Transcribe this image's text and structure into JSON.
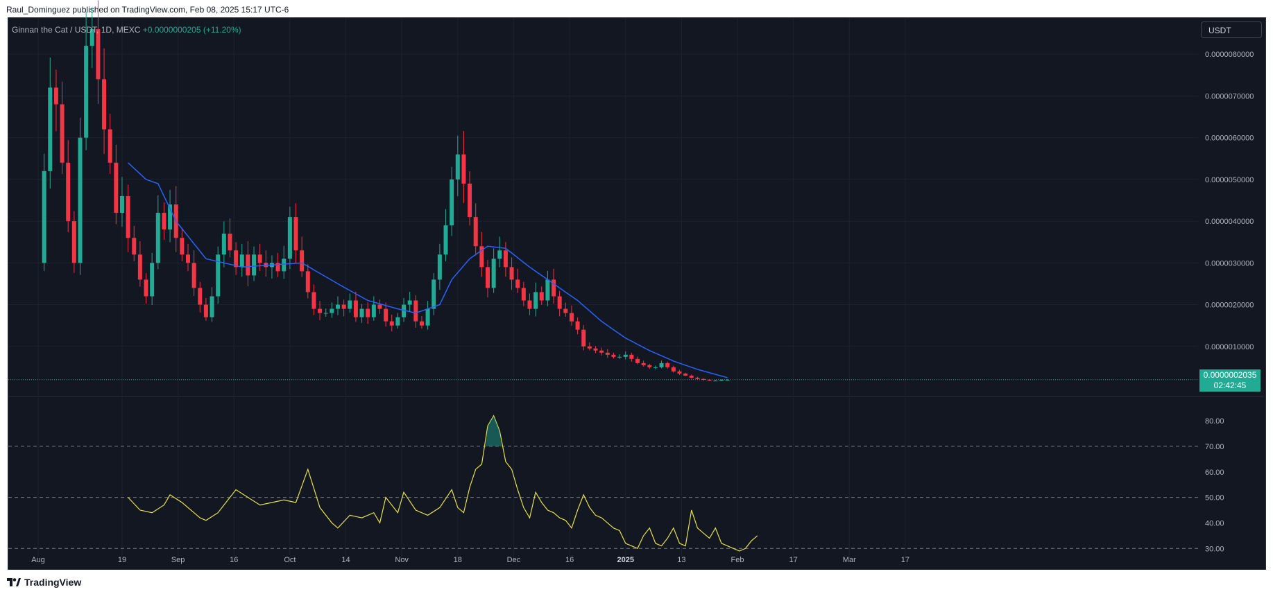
{
  "header": {
    "publisher_line": "Raul_Dominguez published on TradingView.com, Feb 08, 2025 15:17 UTC-6"
  },
  "footer": {
    "brand": "TradingView"
  },
  "legend": {
    "symbol": "Ginnan the Cat / USDT, 1D, MEXC",
    "change": "+0.0000000205 (+11.20%)"
  },
  "currency_button": "USDT",
  "last_price": {
    "value": "0.0000002035",
    "countdown": "02:42:45"
  },
  "colors": {
    "background": "#131722",
    "up": "#22ab94",
    "down": "#f23645",
    "ma": "#2962ff",
    "rsi": "#e6e24a",
    "grid": "#1e222d",
    "text": "#b2b5be"
  },
  "chart_data": [
    {
      "type": "candlestick",
      "title": "Ginnan the Cat / USDT, 1D, MEXC",
      "x_tick_labels": [
        "Aug",
        "19",
        "Sep",
        "16",
        "Oct",
        "14",
        "Nov",
        "18",
        "Dec",
        "16",
        "2025",
        "13",
        "Feb",
        "17",
        "Mar",
        "17"
      ],
      "y_tick_labels": [
        "0.0000080000",
        "0.0000070000",
        "0.0000060000",
        "0.0000050000",
        "0.0000040000",
        "0.0000030000",
        "0.0000020000",
        "0.0000010000"
      ],
      "ylim": [
        0,
        8.8e-06
      ],
      "last_price": 2.035e-07,
      "series": [
        {
          "name": "price",
          "kind": "ohlc",
          "anchors": [
            [
              0,
              3.0
            ],
            [
              1,
              5.2
            ],
            [
              2,
              7.2
            ],
            [
              3,
              6.8
            ],
            [
              4,
              5.4
            ],
            [
              5,
              4.0
            ],
            [
              6,
              3.0
            ],
            [
              7,
              6.0
            ],
            [
              8,
              8.2
            ],
            [
              9,
              8.6
            ],
            [
              10,
              7.4
            ],
            [
              11,
              6.2
            ],
            [
              12,
              5.4
            ],
            [
              13,
              4.2
            ],
            [
              14,
              4.6
            ],
            [
              15,
              3.6
            ],
            [
              16,
              3.2
            ],
            [
              17,
              2.6
            ],
            [
              18,
              2.2
            ],
            [
              19,
              3.0
            ],
            [
              20,
              4.2
            ],
            [
              21,
              3.8
            ],
            [
              22,
              4.4
            ],
            [
              23,
              3.6
            ],
            [
              24,
              3.2
            ],
            [
              25,
              3.0
            ],
            [
              26,
              2.4
            ],
            [
              27,
              2.0
            ],
            [
              28,
              1.7
            ],
            [
              29,
              2.2
            ],
            [
              30,
              3.2
            ],
            [
              31,
              3.7
            ],
            [
              32,
              3.3
            ],
            [
              33,
              2.9
            ],
            [
              34,
              3.2
            ],
            [
              35,
              2.7
            ],
            [
              36,
              3.2
            ],
            [
              37,
              3.0
            ],
            [
              38,
              2.9
            ],
            [
              39,
              3.0
            ],
            [
              40,
              2.8
            ],
            [
              41,
              3.1
            ],
            [
              42,
              4.1
            ],
            [
              43,
              3.3
            ],
            [
              44,
              2.8
            ],
            [
              45,
              2.3
            ],
            [
              46,
              1.9
            ],
            [
              47,
              1.8
            ],
            [
              48,
              1.8
            ],
            [
              49,
              1.9
            ],
            [
              50,
              2.0
            ],
            [
              51,
              1.9
            ],
            [
              52,
              2.1
            ],
            [
              53,
              1.7
            ],
            [
              54,
              1.9
            ],
            [
              55,
              1.7
            ],
            [
              56,
              2.0
            ],
            [
              57,
              1.9
            ],
            [
              58,
              1.6
            ],
            [
              59,
              1.5
            ],
            [
              60,
              1.7
            ],
            [
              61,
              2.0
            ],
            [
              62,
              2.1
            ],
            [
              63,
              1.6
            ],
            [
              64,
              1.5
            ],
            [
              65,
              1.9
            ],
            [
              66,
              2.6
            ],
            [
              67,
              3.2
            ],
            [
              68,
              3.9
            ],
            [
              69,
              5.0
            ],
            [
              70,
              5.6
            ],
            [
              71,
              4.9
            ],
            [
              72,
              4.1
            ],
            [
              73,
              3.4
            ],
            [
              74,
              2.9
            ],
            [
              75,
              2.4
            ],
            [
              76,
              3.1
            ],
            [
              77,
              3.3
            ],
            [
              78,
              2.9
            ],
            [
              79,
              2.6
            ],
            [
              80,
              2.4
            ],
            [
              81,
              2.1
            ],
            [
              82,
              1.9
            ],
            [
              83,
              2.3
            ],
            [
              84,
              2.1
            ],
            [
              85,
              2.6
            ],
            [
              86,
              2.2
            ],
            [
              87,
              1.9
            ],
            [
              88,
              1.8
            ],
            [
              89,
              1.6
            ],
            [
              90,
              1.4
            ],
            [
              91,
              1.0
            ],
            [
              92,
              0.95
            ],
            [
              93,
              0.9
            ],
            [
              94,
              0.85
            ],
            [
              95,
              0.8
            ],
            [
              96,
              0.75
            ],
            [
              97,
              0.75
            ],
            [
              98,
              0.8
            ],
            [
              99,
              0.7
            ],
            [
              100,
              0.6
            ],
            [
              101,
              0.55
            ],
            [
              102,
              0.5
            ],
            [
              103,
              0.5
            ],
            [
              104,
              0.6
            ],
            [
              105,
              0.5
            ],
            [
              106,
              0.4
            ],
            [
              107,
              0.35
            ],
            [
              108,
              0.3
            ],
            [
              109,
              0.25
            ],
            [
              110,
              0.22
            ],
            [
              111,
              0.2
            ],
            [
              112,
              0.18
            ],
            [
              113,
              0.18
            ],
            [
              114,
              0.2
            ],
            [
              115,
              0.2
            ]
          ]
        },
        {
          "name": "MA",
          "anchors": [
            [
              15,
              5.4
            ],
            [
              18,
              5.0
            ],
            [
              20,
              4.9
            ],
            [
              23,
              4.0
            ],
            [
              28,
              3.1
            ],
            [
              34,
              2.9
            ],
            [
              39,
              2.95
            ],
            [
              44,
              3.0
            ],
            [
              50,
              2.5
            ],
            [
              55,
              2.1
            ],
            [
              60,
              1.9
            ],
            [
              63,
              1.8
            ],
            [
              67,
              2.0
            ],
            [
              69,
              2.6
            ],
            [
              72,
              3.1
            ],
            [
              75,
              3.4
            ],
            [
              78,
              3.35
            ],
            [
              82,
              2.9
            ],
            [
              86,
              2.5
            ],
            [
              90,
              2.1
            ],
            [
              94,
              1.6
            ],
            [
              98,
              1.2
            ],
            [
              102,
              0.9
            ],
            [
              106,
              0.65
            ],
            [
              110,
              0.45
            ],
            [
              115,
              0.25
            ]
          ]
        }
      ]
    },
    {
      "type": "line",
      "title": "",
      "y_tick_labels": [
        "80.00",
        "70.00",
        "60.00",
        "50.00",
        "40.00",
        "30.00"
      ],
      "ylim": [
        26,
        86
      ],
      "guide_levels": [
        70,
        50,
        30
      ],
      "series": [
        {
          "name": "RSI",
          "anchors": [
            [
              15,
              50
            ],
            [
              17,
              45
            ],
            [
              19,
              44
            ],
            [
              21,
              47
            ],
            [
              22,
              51
            ],
            [
              24,
              48
            ],
            [
              26,
              44
            ],
            [
              27,
              42
            ],
            [
              28,
              41
            ],
            [
              30,
              44
            ],
            [
              31,
              47
            ],
            [
              33,
              53
            ],
            [
              35,
              50
            ],
            [
              37,
              47
            ],
            [
              39,
              48
            ],
            [
              41,
              49
            ],
            [
              43,
              48
            ],
            [
              45,
              61
            ],
            [
              47,
              46
            ],
            [
              49,
              40
            ],
            [
              50,
              38
            ],
            [
              52,
              43
            ],
            [
              54,
              42
            ],
            [
              56,
              44
            ],
            [
              57,
              40
            ],
            [
              58,
              50
            ],
            [
              60,
              44
            ],
            [
              61,
              52
            ],
            [
              63,
              45
            ],
            [
              65,
              43
            ],
            [
              67,
              46
            ],
            [
              69,
              53
            ],
            [
              70,
              46
            ],
            [
              71,
              44
            ],
            [
              72,
              54
            ],
            [
              73,
              61
            ],
            [
              74,
              63
            ],
            [
              75,
              78
            ],
            [
              76,
              82
            ],
            [
              77,
              76
            ],
            [
              78,
              64
            ],
            [
              79,
              61
            ],
            [
              80,
              53
            ],
            [
              81,
              46
            ],
            [
              82,
              42
            ],
            [
              83,
              52
            ],
            [
              84,
              48
            ],
            [
              85,
              45
            ],
            [
              86,
              44
            ],
            [
              87,
              42
            ],
            [
              88,
              41
            ],
            [
              89,
              38
            ],
            [
              90,
              45
            ],
            [
              91,
              51
            ],
            [
              92,
              46
            ],
            [
              93,
              43
            ],
            [
              94,
              42
            ],
            [
              95,
              40
            ],
            [
              96,
              38
            ],
            [
              97,
              37
            ],
            [
              98,
              32
            ],
            [
              99,
              31
            ],
            [
              100,
              30
            ],
            [
              101,
              35
            ],
            [
              102,
              38
            ],
            [
              103,
              32
            ],
            [
              104,
              31
            ],
            [
              105,
              34
            ],
            [
              106,
              38
            ],
            [
              107,
              32
            ],
            [
              108,
              31
            ],
            [
              109,
              45
            ],
            [
              110,
              38
            ],
            [
              111,
              36
            ],
            [
              112,
              34
            ],
            [
              113,
              38
            ],
            [
              114,
              32
            ],
            [
              115,
              31
            ],
            [
              116,
              30
            ],
            [
              117,
              29
            ],
            [
              118,
              30
            ],
            [
              119,
              33
            ],
            [
              120,
              35
            ]
          ]
        }
      ]
    }
  ]
}
